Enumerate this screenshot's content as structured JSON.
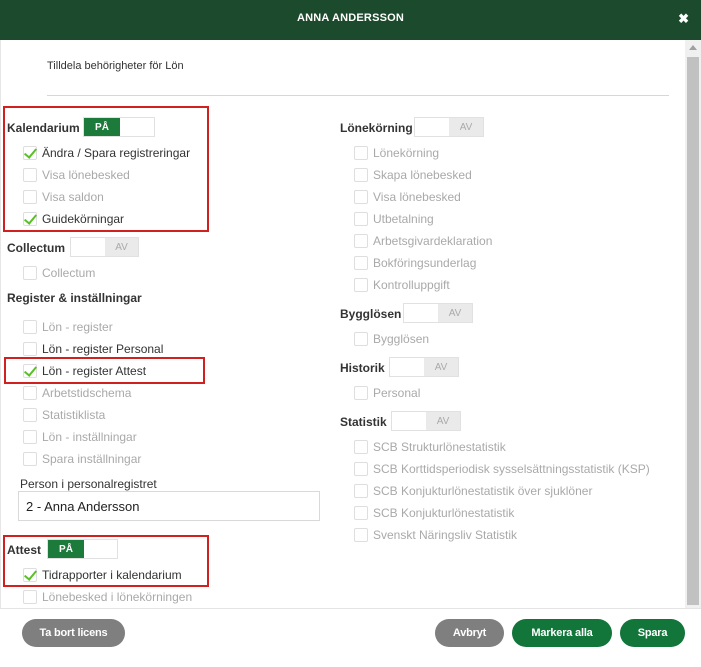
{
  "dialog": {
    "title": "ANNA ANDERSSON",
    "subtitle": "Tilldela behörigheter för Lön",
    "colors": {
      "header": "#1c4a2c",
      "accent_green": "#1c7a3b",
      "highlight_box": "#d12020",
      "check": "#5bbf2a"
    }
  },
  "icons": {
    "close": "close-icon",
    "check": "check-icon"
  },
  "left": {
    "kalendarium": {
      "title": "Kalendarium",
      "toggle": {
        "on_label": "PÅ",
        "state": "on"
      },
      "items": [
        {
          "label": "Ändra / Spara registreringar",
          "checked": true,
          "enabled": true
        },
        {
          "label": "Visa lönebesked",
          "checked": false,
          "enabled": false
        },
        {
          "label": "Visa saldon",
          "checked": false,
          "enabled": false
        },
        {
          "label": "Guidekörningar",
          "checked": true,
          "enabled": true
        }
      ]
    },
    "collectum": {
      "title": "Collectum",
      "toggle": {
        "off_label": "AV",
        "state": "off"
      },
      "items": [
        {
          "label": "Collectum",
          "checked": false,
          "enabled": false
        }
      ]
    },
    "register": {
      "title": "Register & inställningar",
      "items": [
        {
          "label": "Lön - register",
          "checked": false,
          "enabled": false
        },
        {
          "label": "Lön - register Personal",
          "checked": false,
          "enabled": true
        },
        {
          "label": "Lön - register Attest",
          "checked": true,
          "enabled": true
        },
        {
          "label": "Arbetstidschema",
          "checked": false,
          "enabled": false
        },
        {
          "label": "Statistiklista",
          "checked": false,
          "enabled": false
        },
        {
          "label": "Lön - inställningar",
          "checked": false,
          "enabled": false
        },
        {
          "label": "Spara inställningar",
          "checked": false,
          "enabled": false
        }
      ]
    },
    "person": {
      "label": "Person i personalregistret",
      "value": "2 - Anna Andersson"
    },
    "attest": {
      "title": "Attest",
      "toggle": {
        "on_label": "PÅ",
        "state": "on"
      },
      "items": [
        {
          "label": "Tidrapporter i kalendarium",
          "checked": true,
          "enabled": true
        },
        {
          "label": "Lönebesked i lönekörningen",
          "checked": false,
          "enabled": false
        }
      ]
    }
  },
  "right": {
    "lonekorning": {
      "title": "Lönekörning",
      "toggle": {
        "off_label": "AV",
        "state": "off"
      },
      "items": [
        {
          "label": "Lönekörning",
          "checked": false,
          "enabled": false
        },
        {
          "label": "Skapa lönebesked",
          "checked": false,
          "enabled": false
        },
        {
          "label": "Visa lönebesked",
          "checked": false,
          "enabled": false
        },
        {
          "label": "Utbetalning",
          "checked": false,
          "enabled": false
        },
        {
          "label": "Arbetsgivardeklaration",
          "checked": false,
          "enabled": false
        },
        {
          "label": "Bokföringsunderlag",
          "checked": false,
          "enabled": false
        },
        {
          "label": "Kontrolluppgift",
          "checked": false,
          "enabled": false
        }
      ]
    },
    "bygglosen": {
      "title": "Bygglösen",
      "toggle": {
        "off_label": "AV",
        "state": "off"
      },
      "items": [
        {
          "label": "Bygglösen",
          "checked": false,
          "enabled": false
        }
      ]
    },
    "historik": {
      "title": "Historik",
      "toggle": {
        "off_label": "AV",
        "state": "off"
      },
      "items": [
        {
          "label": "Personal",
          "checked": false,
          "enabled": false
        }
      ]
    },
    "statistik": {
      "title": "Statistik",
      "toggle": {
        "off_label": "AV",
        "state": "off"
      },
      "items": [
        {
          "label": "SCB Strukturlönestatistik",
          "checked": false,
          "enabled": false
        },
        {
          "label": "SCB Korttidsperiodisk sysselsättningsstatistik (KSP)",
          "checked": false,
          "enabled": false
        },
        {
          "label": "SCB Konjukturlönestatistik över sjuklöner",
          "checked": false,
          "enabled": false
        },
        {
          "label": "SCB Konjukturlönestatistik",
          "checked": false,
          "enabled": false
        },
        {
          "label": "Svenskt Näringsliv Statistik",
          "checked": false,
          "enabled": false
        }
      ]
    }
  },
  "footer": {
    "remove_license": "Ta bort licens",
    "cancel": "Avbryt",
    "select_all": "Markera alla",
    "save": "Spara"
  }
}
